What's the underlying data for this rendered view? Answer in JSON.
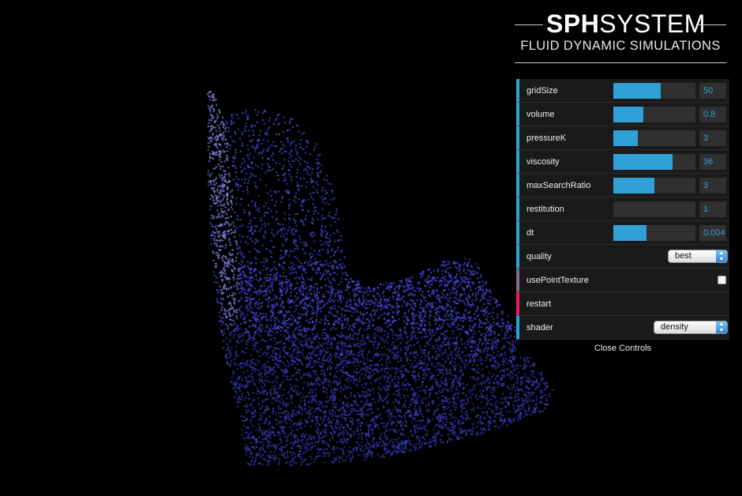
{
  "header": {
    "title_bold": "SPH",
    "title_light": "SYSTEM",
    "subtitle": "FLUID DYNAMIC SIMULATIONS"
  },
  "controls": {
    "sliders": [
      {
        "label": "gridSize",
        "value": "50",
        "fill_fraction": 0.58
      },
      {
        "label": "volume",
        "value": "0.8",
        "fill_fraction": 0.37
      },
      {
        "label": "pressureK",
        "value": "3",
        "fill_fraction": 0.3
      },
      {
        "label": "viscosity",
        "value": "36",
        "fill_fraction": 0.72
      },
      {
        "label": "maxSearchRatio",
        "value": "3",
        "fill_fraction": 0.5
      },
      {
        "label": "restitution",
        "value": "1",
        "fill_fraction": 0.0
      },
      {
        "label": "dt",
        "value": "0.004",
        "fill_fraction": 0.4
      }
    ],
    "quality": {
      "label": "quality",
      "value": "best"
    },
    "usePointTexture": {
      "label": "usePointTexture",
      "checked": false
    },
    "restart": {
      "label": "restart"
    },
    "shader": {
      "label": "shader",
      "value": "density"
    },
    "close_label": "Close Controls"
  },
  "colors": {
    "accent": "#2fa1d6",
    "boolean_marker": "#806787",
    "function_marker": "#e61d5f",
    "particles": "#6a6cf0",
    "background": "#000000"
  }
}
